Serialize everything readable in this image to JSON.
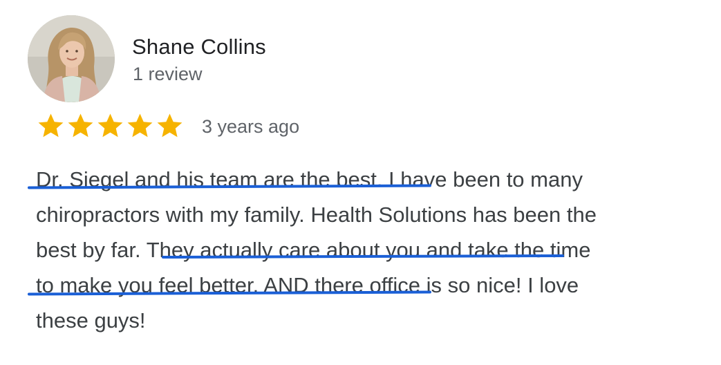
{
  "reviewer": {
    "name": "Shane Collins",
    "review_count": "1 review",
    "avatar_icon": "profile-photo"
  },
  "rating": {
    "stars": 5,
    "max_stars": 5,
    "star_color": "#f6b300",
    "date": "3 years ago"
  },
  "review": {
    "lines": [
      "Dr. Siegel and his team are the best. I have been to many",
      "chiropractors with my family. Health Solutions has been the",
      "best by far. They actually care about you and take the time",
      "to make you feel better. AND there office is so nice! I love",
      "these guys!"
    ]
  },
  "highlight": {
    "color": "#1a5fd6"
  }
}
